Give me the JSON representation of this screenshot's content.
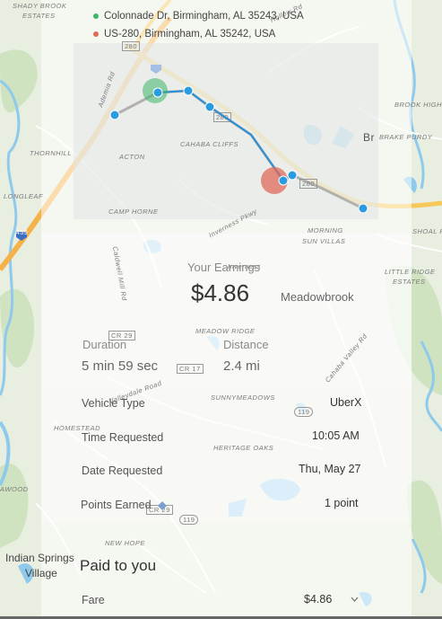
{
  "route": {
    "pickup_address": "Colonnade Dr, Birmingham, AL 35243, USA",
    "dropoff_address": "US-280, Birmingham, AL 35242, USA",
    "pickup_color": "#3db56b",
    "dropoff_color": "#e06a5a",
    "route_color": "#2b8fd4"
  },
  "map": {
    "labels": {
      "shady_brook_1": "SHADY BROOK",
      "shady_brook_2": "ESTATES",
      "thornhill": "THORNHILL",
      "longleaf": "LONGLEAF",
      "acton": "ACTON",
      "cahaba_cliffs": "CAHABA CLIFFS",
      "camp_horne": "CAMP HORNE",
      "brook_high": "BROOK HIGH",
      "brake_purdy": "BRAKE PURDY",
      "br": "Br",
      "morning_sun_1": "MORNING",
      "morning_sun_2": "SUN VILLAS",
      "shoal": "SHOAL R",
      "little_ridge_1": "LITTLE RIDGE",
      "little_ridge_2": "ESTATES",
      "meadowbrook": "Meadowbrook",
      "meadow_ridge": "MEADOW RIDGE",
      "sunnymeadows": "SUNNYMEADOWS",
      "homestead": "HOMESTEAD",
      "heritage_oaks": "HERITAGE OAKS",
      "awood": "AWOOD",
      "new_hope": "NEW HOPE",
      "indian_springs_1": "Indian Springs",
      "indian_springs_2": "Village",
      "cr29_a": "CR 29",
      "cr29_b": "CR 29",
      "cr17": "CR 17",
      "r119_a": "119",
      "r119_b": "119",
      "r280_a": "280",
      "r280_b": "280",
      "r280_c": "280",
      "r459": "459",
      "inverness": "Inverness Pkwy",
      "caldwell": "Caldwell Mill Rd",
      "cahaba_valley": "Cahaba Valley Rd",
      "valleydale": "Valleydale Road",
      "cahaba_river": "Cahaba River Rd",
      "hollow": "Hollow Rd",
      "ademia": "Ademia Rd",
      "inverness_center": "Inverness"
    }
  },
  "earnings": {
    "label": "Your Earnings",
    "amount": "$4.86"
  },
  "stats": {
    "duration_label": "Duration",
    "duration_value": "5 min 59 sec",
    "distance_label": "Distance",
    "distance_value": "2.4 mi"
  },
  "details": {
    "vehicle_type_label": "Vehicle Type",
    "vehicle_type_value": "UberX",
    "time_requested_label": "Time Requested",
    "time_requested_value": "10:05 AM",
    "date_requested_label": "Date Requested",
    "date_requested_value": "Thu, May 27",
    "points_earned_label": "Points Earned",
    "points_earned_value": "1 point"
  },
  "payment": {
    "title": "Paid to you",
    "fare_label": "Fare",
    "fare_value": "$4.86"
  }
}
